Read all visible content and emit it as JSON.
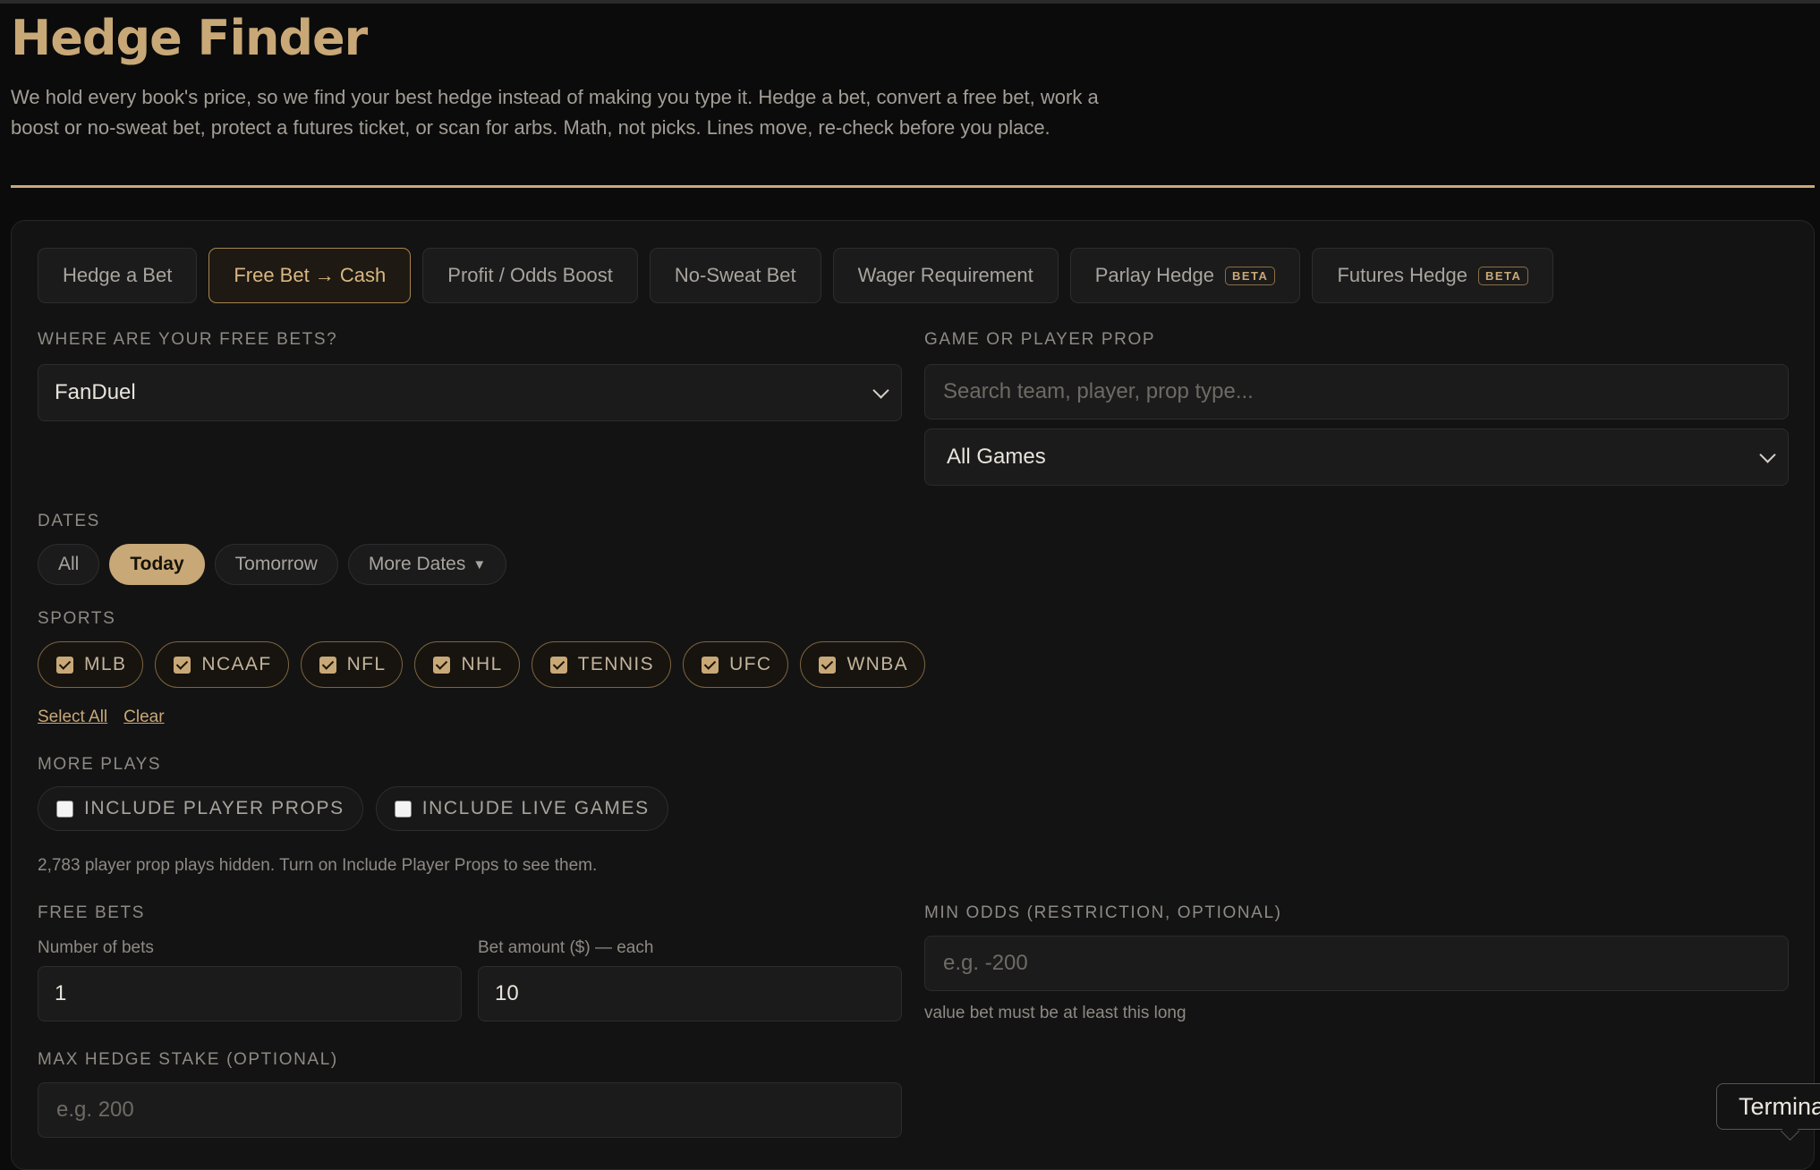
{
  "header": {
    "title": "Hedge Finder",
    "subtitle": "We hold every book's price, so we find your best hedge instead of making you type it. Hedge a bet, convert a free bet, work a boost or no-sweat bet, protect a futures ticket, or scan for arbs. Math, not picks. Lines move, re-check before you place."
  },
  "tabs": [
    {
      "label": "Hedge a Bet",
      "active": false
    },
    {
      "label": "Free Bet → Cash",
      "active": true
    },
    {
      "label": "Profit / Odds Boost",
      "active": false
    },
    {
      "label": "No-Sweat Bet",
      "active": false
    },
    {
      "label": "Wager Requirement",
      "active": false
    },
    {
      "label": "Parlay Hedge",
      "badge": "BETA",
      "active": false
    },
    {
      "label": "Futures Hedge",
      "badge": "BETA",
      "active": false
    }
  ],
  "book": {
    "label": "WHERE ARE YOUR FREE BETS?",
    "value": "FanDuel"
  },
  "game": {
    "label": "GAME OR PLAYER PROP",
    "search_placeholder": "Search team, player, prop type...",
    "games_value": "All Games"
  },
  "dates": {
    "label": "DATES",
    "options": [
      "All",
      "Today",
      "Tomorrow",
      "More Dates"
    ],
    "active": "Today",
    "more_caret": "▼"
  },
  "sports": {
    "label": "SPORTS",
    "items": [
      {
        "label": "MLB",
        "checked": true
      },
      {
        "label": "NCAAF",
        "checked": true
      },
      {
        "label": "NFL",
        "checked": true
      },
      {
        "label": "NHL",
        "checked": true
      },
      {
        "label": "TENNIS",
        "checked": true
      },
      {
        "label": "UFC",
        "checked": true
      },
      {
        "label": "WNBA",
        "checked": true
      }
    ],
    "select_all": "Select All",
    "clear": "Clear"
  },
  "more_plays": {
    "label": "MORE PLAYS",
    "options": [
      {
        "label": "INCLUDE PLAYER PROPS",
        "checked": false
      },
      {
        "label": "INCLUDE LIVE GAMES",
        "checked": false
      }
    ],
    "note": "2,783 player prop plays hidden. Turn on Include Player Props to see them."
  },
  "free_bets": {
    "label": "FREE BETS",
    "count_label": "Number of bets",
    "count_value": "1",
    "amount_label": "Bet amount ($) — each",
    "amount_value": "10"
  },
  "min_odds": {
    "label": "MIN ODDS (RESTRICTION, OPTIONAL)",
    "placeholder": "e.g. -200",
    "hint": "value bet must be at least this long"
  },
  "max_hedge": {
    "label": "MAX HEDGE STAKE (OPTIONAL)",
    "placeholder": "e.g. 200"
  },
  "tooltip": {
    "text": "Termina"
  },
  "colors": {
    "accent": "#c9a877",
    "background": "#0b0b0b",
    "panel": "#131313"
  }
}
